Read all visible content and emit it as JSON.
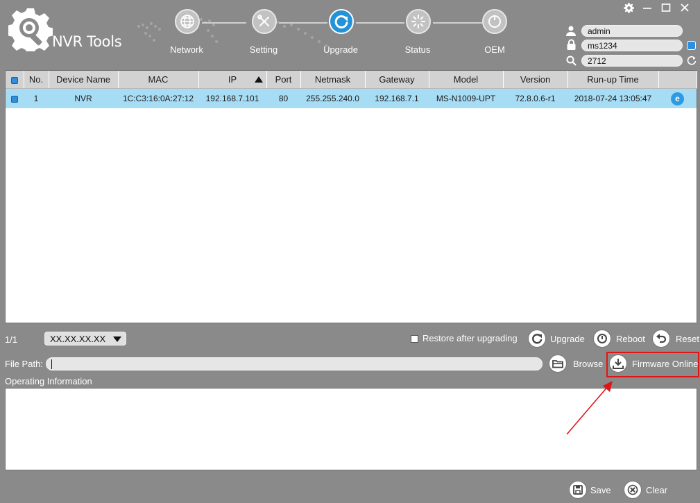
{
  "app": {
    "title": "NVR Tools"
  },
  "nav": [
    {
      "label": "Network",
      "icon": "globe-icon",
      "active": false
    },
    {
      "label": "Setting",
      "icon": "tools-icon",
      "active": false
    },
    {
      "label": "Upgrade",
      "icon": "upgrade-icon",
      "active": true
    },
    {
      "label": "Status",
      "icon": "status-icon",
      "active": false
    },
    {
      "label": "OEM",
      "icon": "oem-icon",
      "active": false
    }
  ],
  "credentials": {
    "username": "admin",
    "password": "ms1234",
    "search": "2712"
  },
  "table": {
    "columns": [
      "No.",
      "Device Name",
      "MAC",
      "IP",
      "Port",
      "Netmask",
      "Gateway",
      "Model",
      "Version",
      "Run-up Time"
    ],
    "sorted_column": "IP",
    "rows": [
      {
        "no": "1",
        "device_name": "NVR",
        "mac": "1C:C3:16:0A:27:12",
        "ip": "192.168.7.101",
        "port": "80",
        "netmask": "255.255.240.0",
        "gateway": "192.168.7.1",
        "model": "MS-N1009-UPT",
        "version": "72.8.0.6-r1",
        "runup_time": "2018-07-24 13:05:47",
        "selected": true
      }
    ]
  },
  "pager": {
    "text": "1/1"
  },
  "version_select": {
    "value": "XX.XX.XX.XX"
  },
  "actions": {
    "restore_label": "Restore after upgrading",
    "upgrade": "Upgrade",
    "reboot": "Reboot",
    "reset": "Reset",
    "browse": "Browse",
    "firmware_online": "Firmware Online",
    "save": "Save",
    "clear": "Clear"
  },
  "file_path": {
    "label": "File Path:",
    "value": ""
  },
  "operating_info": {
    "label": "Operating Information"
  },
  "colors": {
    "accent": "#2492d8",
    "selection": "#a7dcf5",
    "highlight_box": "#e01515",
    "background": "#8a8a8a"
  }
}
